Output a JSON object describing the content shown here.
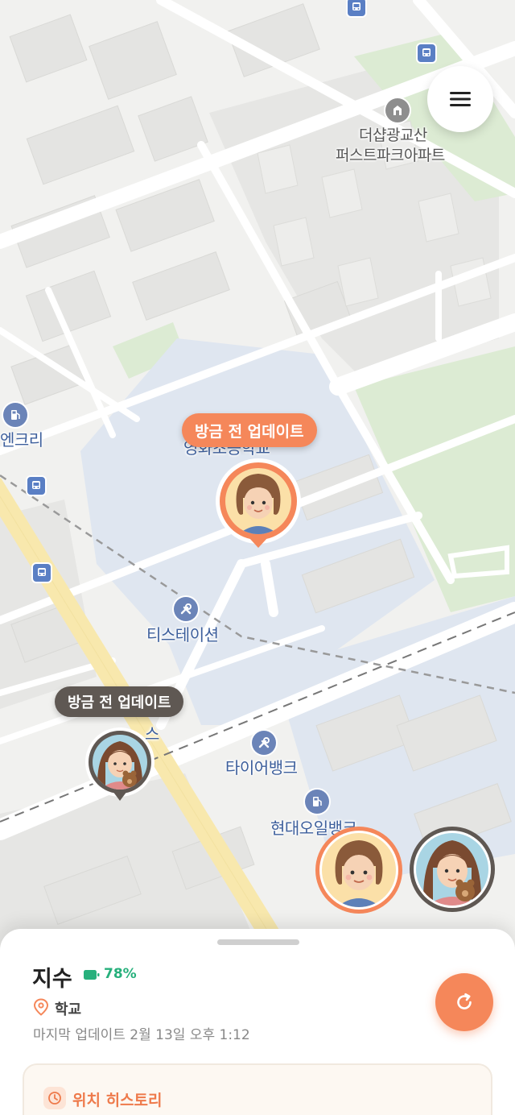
{
  "map": {
    "labels": {
      "apartment": [
        "더샵광교산",
        "퍼스트파크아파트"
      ],
      "school_left": "엔크리",
      "school_under_bubble": "영화초등학교",
      "tstation": "티스테이션",
      "tirebank": "타이어뱅크",
      "hyundai_oil": "현대오일뱅크",
      "left_partial": "스"
    }
  },
  "markers": {
    "jisu": {
      "bubble_text": "방금 전 업데이트",
      "accent": "#f5875a"
    },
    "sister": {
      "bubble_text": "방금 전 업데이트",
      "accent": "#5f5853"
    }
  },
  "sheet": {
    "child_name": "지수",
    "battery": "78%",
    "place": "학교",
    "last_update": "마지막 업데이트 2월 13일 오후 1:12",
    "history_title": "위치 히스토리"
  },
  "colors": {
    "accent": "#f5875a",
    "battery": "#27b07c",
    "dark_marker": "#5f5853"
  },
  "icons": [
    "menu-icon",
    "refresh-icon",
    "battery-icon",
    "location-pin-icon",
    "clock-icon",
    "bus-stop-icon",
    "fuel-station-icon",
    "repair-icon",
    "building-icon"
  ]
}
